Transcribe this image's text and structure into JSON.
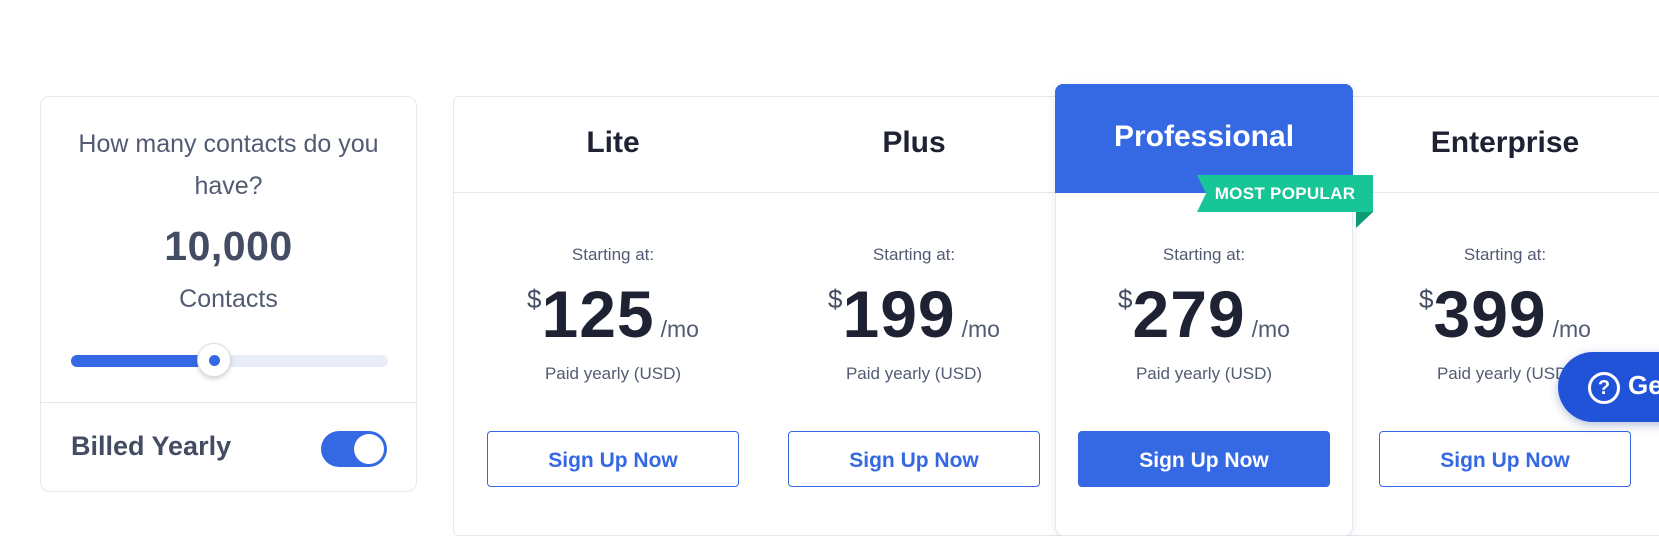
{
  "contacts": {
    "question": "How many contacts do you have?",
    "value": "10,000",
    "unit": "Contacts",
    "slider_fraction": 0.45
  },
  "billing": {
    "label": "Billed Yearly",
    "toggle_on": true
  },
  "plans": [
    {
      "name": "Lite",
      "starting": "Starting at:",
      "currency": "$",
      "price": "125",
      "period": "/mo",
      "note": "Paid yearly (USD)",
      "cta": "Sign Up Now"
    },
    {
      "name": "Plus",
      "starting": "Starting at:",
      "currency": "$",
      "price": "199",
      "period": "/mo",
      "note": "Paid yearly (USD)",
      "cta": "Sign Up Now"
    },
    {
      "name": "Professional",
      "starting": "Starting at:",
      "currency": "$",
      "price": "279",
      "period": "/mo",
      "note": "Paid yearly (USD)",
      "cta": "Sign Up Now",
      "badge": "MOST POPULAR"
    },
    {
      "name": "Enterprise",
      "starting": "Starting at:",
      "currency": "$",
      "price": "399",
      "period": "/mo",
      "note": "Paid yearly (USD)",
      "cta": "Sign Up Now"
    }
  ],
  "help": {
    "icon": "question-circle-icon",
    "label": "Get help"
  },
  "colors": {
    "accent": "#3568e3",
    "badge": "#17c596",
    "text_dark": "#1f2233",
    "text_muted": "#525b72"
  }
}
